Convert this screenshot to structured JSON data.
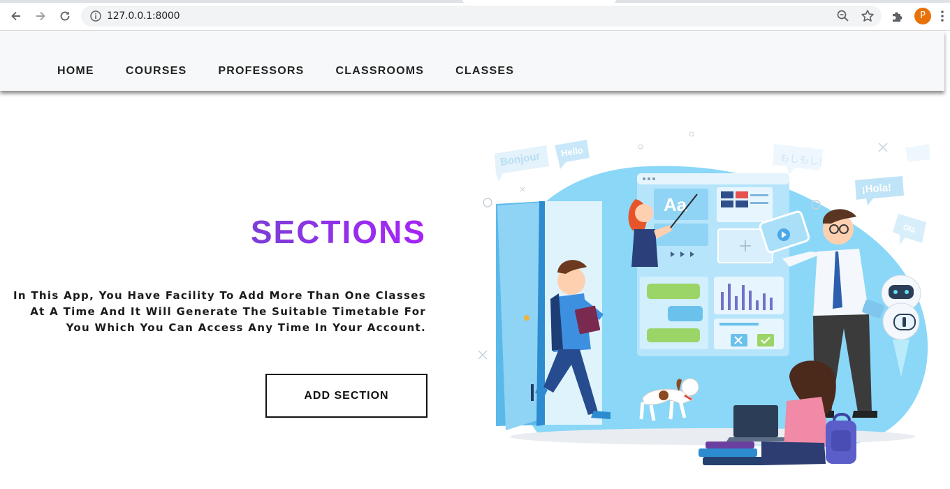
{
  "browser": {
    "url": "127.0.0.1:8000",
    "profile_initial": "P",
    "profile_color": "#e8710a",
    "icons": [
      "back-icon",
      "forward-icon",
      "reload-icon",
      "info-icon",
      "zoom-icon",
      "star-icon",
      "extensions-icon",
      "menu-icon"
    ]
  },
  "nav": {
    "items": [
      "HOME",
      "COURSES",
      "PROFESSORS",
      "CLASSROOMS",
      "CLASSES"
    ]
  },
  "hero": {
    "title": "SECTIONS",
    "description": "In This App, You Have Facility To Add More Than One Classes At A Time And It Will Generate The Suitable Timetable For You Which You Can Access Any Time In Your Account.",
    "button": "ADD SECTION",
    "title_gradient": [
      "#7a3fd6",
      "#a524f5"
    ]
  },
  "illustration": {
    "bubbles": [
      "Bonjour",
      "Hello",
      "もしもし!",
      "¡Hola!",
      "Olá"
    ],
    "panel_label": "Aa",
    "primary_color": "#6ec8f5"
  }
}
